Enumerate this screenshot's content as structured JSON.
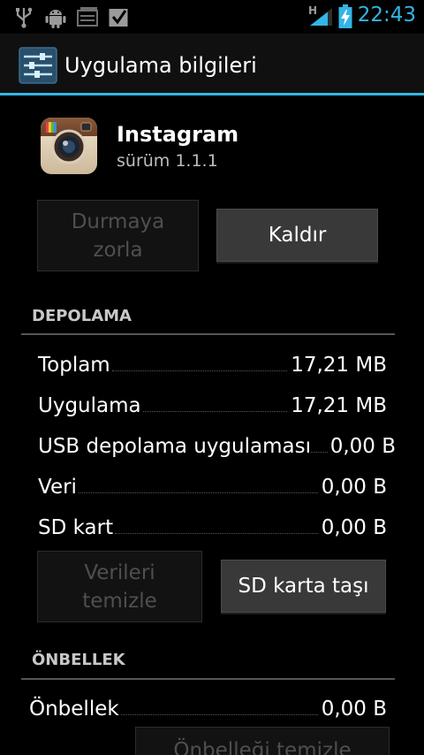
{
  "status_bar": {
    "time": "22:43",
    "network_type": "H",
    "icons": [
      "usb-icon",
      "android-debug-icon",
      "gallery-icon",
      "checkbox-icon",
      "signal-icon",
      "battery-charging-icon"
    ]
  },
  "action_bar": {
    "title": "Uygulama bilgileri",
    "icon": "settings-sliders-icon",
    "accent_color": "#33b5e5"
  },
  "app": {
    "name": "Instagram",
    "version": "sürüm 1.1.1",
    "icon": "instagram-camera-icon"
  },
  "buttons": {
    "force_stop_line1": "Durmaya",
    "force_stop_line2": "zorla",
    "uninstall": "Kaldır",
    "clear_data_line1": "Verileri",
    "clear_data_line2": "temizle",
    "move_to_sd": "SD karta taşı",
    "clear_cache": "Önbelleği temizle"
  },
  "storage": {
    "header": "DEPOLAMA",
    "rows": [
      {
        "label": "Toplam",
        "value": "17,21 MB"
      },
      {
        "label": "Uygulama",
        "value": "17,21 MB"
      },
      {
        "label": "USB depolama uygulaması",
        "value": "0,00 B"
      },
      {
        "label": "Veri",
        "value": "0,00 B"
      },
      {
        "label": "SD kart",
        "value": "0,00 B"
      }
    ]
  },
  "cache": {
    "header": "ÖNBELLEK",
    "label": "Önbellek",
    "value": "0,00 B"
  }
}
